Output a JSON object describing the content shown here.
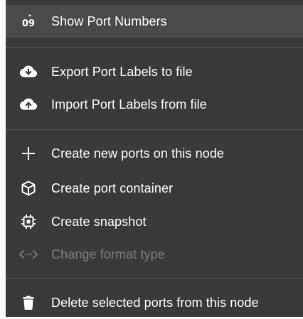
{
  "menu": {
    "items": [
      {
        "label": "Show Port Numbers",
        "icon": "port-numbers-icon"
      },
      {
        "label": "Export Port Labels to file",
        "icon": "cloud-download-icon"
      },
      {
        "label": "Import Port Labels from file",
        "icon": "cloud-upload-icon"
      },
      {
        "label": "Create new ports on this node",
        "icon": "plus-icon"
      },
      {
        "label": "Create port container",
        "icon": "cube-icon"
      },
      {
        "label": "Create snapshot",
        "icon": "chip-icon"
      },
      {
        "label": "Change format type",
        "icon": "code-arrows-icon",
        "disabled": true
      },
      {
        "label": "Delete selected ports from this node",
        "icon": "trash-icon"
      }
    ],
    "port_numbers_glyph": "09"
  },
  "colors": {
    "menu_background": "#3a3a3a",
    "highlight_background": "#4a4a4a",
    "text": "#ffffff",
    "disabled_text": "#7b7b7b",
    "divider": "#555555"
  }
}
